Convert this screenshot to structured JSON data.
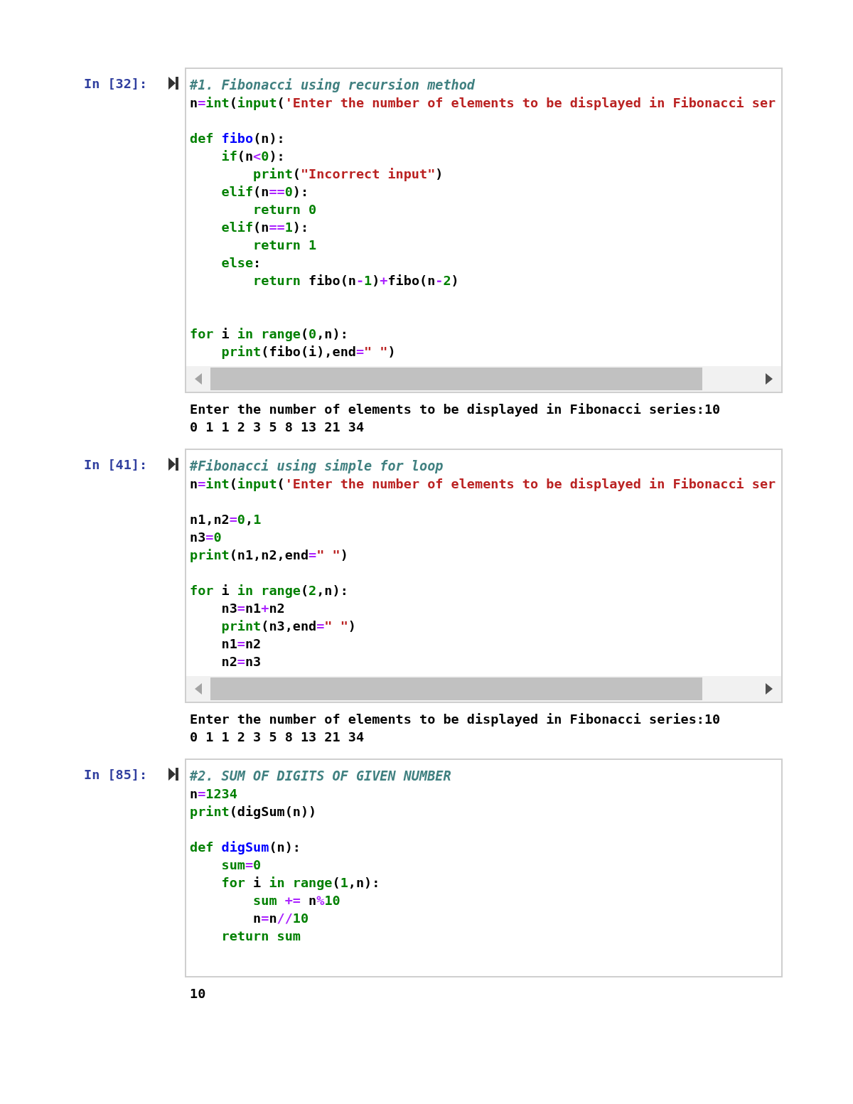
{
  "cells": [
    {
      "prompt": "In [32]:",
      "horizontal_scrollbar": true,
      "code": [
        {
          "kind": "code",
          "tokens": [
            {
              "kind": "com",
              "text": "#1. Fibonacci using recursion method"
            }
          ]
        },
        {
          "kind": "code",
          "tokens": [
            {
              "kind": "plain",
              "text": "n"
            },
            {
              "kind": "op",
              "text": "="
            },
            {
              "kind": "bi",
              "text": "int"
            },
            {
              "kind": "plain",
              "text": "("
            },
            {
              "kind": "bi",
              "text": "input"
            },
            {
              "kind": "plain",
              "text": "("
            },
            {
              "kind": "str",
              "text": "'Enter the number of elements to be displayed in Fibonacci ser"
            }
          ]
        },
        {
          "kind": "blank"
        },
        {
          "kind": "code",
          "tokens": [
            {
              "kind": "kw",
              "text": "def"
            },
            {
              "kind": "fn",
              "text": " fibo"
            },
            {
              "kind": "plain",
              "text": "(n):"
            }
          ]
        },
        {
          "kind": "code",
          "tokens": [
            {
              "kind": "kw",
              "text": "    if"
            },
            {
              "kind": "plain",
              "text": "(n"
            },
            {
              "kind": "op",
              "text": "<"
            },
            {
              "kind": "num",
              "text": "0"
            },
            {
              "kind": "plain",
              "text": "):"
            }
          ]
        },
        {
          "kind": "code",
          "tokens": [
            {
              "kind": "bi",
              "text": "        print"
            },
            {
              "kind": "plain",
              "text": "("
            },
            {
              "kind": "str",
              "text": "\"Incorrect input\""
            },
            {
              "kind": "plain",
              "text": ")"
            }
          ]
        },
        {
          "kind": "code",
          "tokens": [
            {
              "kind": "kw",
              "text": "    elif"
            },
            {
              "kind": "plain",
              "text": "(n"
            },
            {
              "kind": "op",
              "text": "=="
            },
            {
              "kind": "num",
              "text": "0"
            },
            {
              "kind": "plain",
              "text": "):"
            }
          ]
        },
        {
          "kind": "code",
          "tokens": [
            {
              "kind": "kw",
              "text": "        return"
            },
            {
              "kind": "num",
              "text": " 0"
            }
          ]
        },
        {
          "kind": "code",
          "tokens": [
            {
              "kind": "kw",
              "text": "    elif"
            },
            {
              "kind": "plain",
              "text": "(n"
            },
            {
              "kind": "op",
              "text": "=="
            },
            {
              "kind": "num",
              "text": "1"
            },
            {
              "kind": "plain",
              "text": "):"
            }
          ]
        },
        {
          "kind": "code",
          "tokens": [
            {
              "kind": "kw",
              "text": "        return"
            },
            {
              "kind": "num",
              "text": " 1"
            }
          ]
        },
        {
          "kind": "code",
          "tokens": [
            {
              "kind": "kw",
              "text": "    else"
            },
            {
              "kind": "plain",
              "text": ":"
            }
          ]
        },
        {
          "kind": "code",
          "tokens": [
            {
              "kind": "kw",
              "text": "        return"
            },
            {
              "kind": "plain",
              "text": " fibo(n"
            },
            {
              "kind": "op",
              "text": "-"
            },
            {
              "kind": "num",
              "text": "1"
            },
            {
              "kind": "plain",
              "text": ")"
            },
            {
              "kind": "op",
              "text": "+"
            },
            {
              "kind": "plain",
              "text": "fibo(n"
            },
            {
              "kind": "op",
              "text": "-"
            },
            {
              "kind": "num",
              "text": "2"
            },
            {
              "kind": "plain",
              "text": ")"
            }
          ]
        },
        {
          "kind": "blank"
        },
        {
          "kind": "blank"
        },
        {
          "kind": "code",
          "tokens": [
            {
              "kind": "kw",
              "text": "for"
            },
            {
              "kind": "plain",
              "text": " i "
            },
            {
              "kind": "kw",
              "text": "in"
            },
            {
              "kind": "bi",
              "text": " range"
            },
            {
              "kind": "plain",
              "text": "("
            },
            {
              "kind": "num",
              "text": "0"
            },
            {
              "kind": "plain",
              "text": ",n):"
            }
          ]
        },
        {
          "kind": "code",
          "tokens": [
            {
              "kind": "bi",
              "text": "    print"
            },
            {
              "kind": "plain",
              "text": "(fibo(i),end"
            },
            {
              "kind": "op",
              "text": "="
            },
            {
              "kind": "str",
              "text": "\" \""
            },
            {
              "kind": "plain",
              "text": ")"
            }
          ]
        }
      ],
      "output": [
        "Enter the number of elements to be displayed in Fibonacci series:10",
        "0 1 1 2 3 5 8 13 21 34"
      ]
    },
    {
      "prompt": "In [41]:",
      "horizontal_scrollbar": true,
      "code": [
        {
          "kind": "code",
          "tokens": [
            {
              "kind": "com",
              "text": "#Fibonacci using simple for loop"
            }
          ]
        },
        {
          "kind": "code",
          "tokens": [
            {
              "kind": "plain",
              "text": "n"
            },
            {
              "kind": "op",
              "text": "="
            },
            {
              "kind": "bi",
              "text": "int"
            },
            {
              "kind": "plain",
              "text": "("
            },
            {
              "kind": "bi",
              "text": "input"
            },
            {
              "kind": "plain",
              "text": "("
            },
            {
              "kind": "str",
              "text": "'Enter the number of elements to be displayed in Fibonacci ser"
            }
          ]
        },
        {
          "kind": "blank"
        },
        {
          "kind": "code",
          "tokens": [
            {
              "kind": "plain",
              "text": "n1,n2"
            },
            {
              "kind": "op",
              "text": "="
            },
            {
              "kind": "num",
              "text": "0"
            },
            {
              "kind": "plain",
              "text": ","
            },
            {
              "kind": "num",
              "text": "1"
            }
          ]
        },
        {
          "kind": "code",
          "tokens": [
            {
              "kind": "plain",
              "text": "n3"
            },
            {
              "kind": "op",
              "text": "="
            },
            {
              "kind": "num",
              "text": "0"
            }
          ]
        },
        {
          "kind": "code",
          "tokens": [
            {
              "kind": "bi",
              "text": "print"
            },
            {
              "kind": "plain",
              "text": "(n1,n2,end"
            },
            {
              "kind": "op",
              "text": "="
            },
            {
              "kind": "str",
              "text": "\" \""
            },
            {
              "kind": "plain",
              "text": ")"
            }
          ]
        },
        {
          "kind": "blank"
        },
        {
          "kind": "code",
          "tokens": [
            {
              "kind": "kw",
              "text": "for"
            },
            {
              "kind": "plain",
              "text": " i "
            },
            {
              "kind": "kw",
              "text": "in"
            },
            {
              "kind": "bi",
              "text": " range"
            },
            {
              "kind": "plain",
              "text": "("
            },
            {
              "kind": "num",
              "text": "2"
            },
            {
              "kind": "plain",
              "text": ",n):"
            }
          ]
        },
        {
          "kind": "code",
          "tokens": [
            {
              "kind": "plain",
              "text": "    n3"
            },
            {
              "kind": "op",
              "text": "="
            },
            {
              "kind": "plain",
              "text": "n1"
            },
            {
              "kind": "op",
              "text": "+"
            },
            {
              "kind": "plain",
              "text": "n2"
            }
          ]
        },
        {
          "kind": "code",
          "tokens": [
            {
              "kind": "bi",
              "text": "    print"
            },
            {
              "kind": "plain",
              "text": "(n3,end"
            },
            {
              "kind": "op",
              "text": "="
            },
            {
              "kind": "str",
              "text": "\" \""
            },
            {
              "kind": "plain",
              "text": ")"
            }
          ]
        },
        {
          "kind": "code",
          "tokens": [
            {
              "kind": "plain",
              "text": "    n1"
            },
            {
              "kind": "op",
              "text": "="
            },
            {
              "kind": "plain",
              "text": "n2"
            }
          ]
        },
        {
          "kind": "code",
          "tokens": [
            {
              "kind": "plain",
              "text": "    n2"
            },
            {
              "kind": "op",
              "text": "="
            },
            {
              "kind": "plain",
              "text": "n3"
            }
          ]
        }
      ],
      "output": [
        "Enter the number of elements to be displayed in Fibonacci series:10",
        "0 1 1 2 3 5 8 13 21 34"
      ]
    },
    {
      "prompt": "In [85]:",
      "horizontal_scrollbar": false,
      "code": [
        {
          "kind": "code",
          "tokens": [
            {
              "kind": "com",
              "text": "#2. SUM OF DIGITS OF GIVEN NUMBER"
            }
          ]
        },
        {
          "kind": "code",
          "tokens": [
            {
              "kind": "plain",
              "text": "n"
            },
            {
              "kind": "op",
              "text": "="
            },
            {
              "kind": "num",
              "text": "1234"
            }
          ]
        },
        {
          "kind": "code",
          "tokens": [
            {
              "kind": "bi",
              "text": "print"
            },
            {
              "kind": "plain",
              "text": "(digSum(n))"
            }
          ]
        },
        {
          "kind": "blank"
        },
        {
          "kind": "code",
          "tokens": [
            {
              "kind": "kw",
              "text": "def"
            },
            {
              "kind": "fn",
              "text": " digSum"
            },
            {
              "kind": "plain",
              "text": "(n):"
            }
          ]
        },
        {
          "kind": "code",
          "tokens": [
            {
              "kind": "bi",
              "text": "    sum"
            },
            {
              "kind": "op",
              "text": "="
            },
            {
              "kind": "num",
              "text": "0"
            }
          ]
        },
        {
          "kind": "code",
          "tokens": [
            {
              "kind": "kw",
              "text": "    for"
            },
            {
              "kind": "plain",
              "text": " i "
            },
            {
              "kind": "kw",
              "text": "in"
            },
            {
              "kind": "bi",
              "text": " range"
            },
            {
              "kind": "plain",
              "text": "("
            },
            {
              "kind": "num",
              "text": "1"
            },
            {
              "kind": "plain",
              "text": ",n):"
            }
          ]
        },
        {
          "kind": "code",
          "tokens": [
            {
              "kind": "bi",
              "text": "        sum"
            },
            {
              "kind": "op",
              "text": " +="
            },
            {
              "kind": "plain",
              "text": " n"
            },
            {
              "kind": "op",
              "text": "%"
            },
            {
              "kind": "num",
              "text": "10"
            }
          ]
        },
        {
          "kind": "code",
          "tokens": [
            {
              "kind": "plain",
              "text": "        n"
            },
            {
              "kind": "op",
              "text": "="
            },
            {
              "kind": "plain",
              "text": "n"
            },
            {
              "kind": "op",
              "text": "//"
            },
            {
              "kind": "num",
              "text": "10"
            }
          ]
        },
        {
          "kind": "code",
          "tokens": [
            {
              "kind": "kw",
              "text": "    return"
            },
            {
              "kind": "bi",
              "text": " sum"
            }
          ]
        }
      ],
      "output": [
        "10"
      ]
    }
  ]
}
